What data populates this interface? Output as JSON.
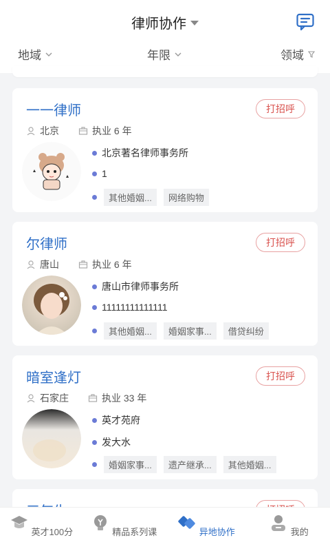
{
  "header": {
    "title": "律师协作"
  },
  "filters": {
    "region": "地域",
    "years": "年限",
    "field": "领域"
  },
  "cards": [
    {
      "name": "一一律师",
      "greet": "打招呼",
      "city": "北京",
      "years": "执业 6 年",
      "firm": "北京著名律师事务所",
      "phone": "1",
      "tags": [
        "其他婚姻...",
        "网络购物"
      ]
    },
    {
      "name": "尔律师",
      "greet": "打招呼",
      "city": "唐山",
      "years": "执业 6 年",
      "firm": "唐山市律师事务所",
      "phone": "11111111111111",
      "tags": [
        "其他婚姻...",
        "婚姻家事...",
        "借贷纠纷"
      ]
    },
    {
      "name": "暗室逢灯",
      "greet": "打招呼",
      "city": "石家庄",
      "years": "执业 33 年",
      "firm": "英才苑府",
      "phone": "发大水",
      "tags": [
        "婚姻家事...",
        "遗产继承...",
        "其他婚姻..."
      ]
    },
    {
      "name": "三气生",
      "greet": "打招呼"
    }
  ],
  "tabs": {
    "t1": "英才100分",
    "t2": "精品系列课",
    "t3": "异地协作",
    "t4": "我的"
  },
  "colors": {
    "accent": "#2f6fc7",
    "greet": "#d9534f"
  }
}
